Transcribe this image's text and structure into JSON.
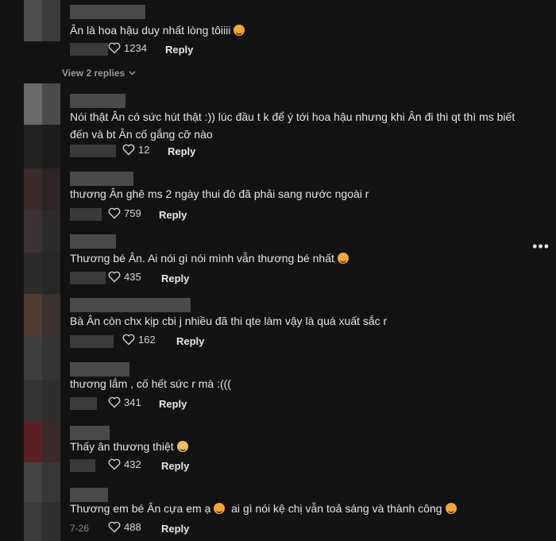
{
  "view_replies": "View 2 replies",
  "more_label": "•••",
  "comments": [
    {
      "text": "Ân là hoa hậu duy nhất lòng tôiiii",
      "likes": "1234",
      "reply": "Reply",
      "date": ""
    },
    {
      "text": "Nói thật Ân có sức hút thật :)) lúc đầu t k để ý tới hoa hậu nhưng khi Ân đi thi qt thì ms biết đến và bt Ân cố gắng cỡ nào",
      "likes": "12",
      "reply": "Reply",
      "date": ""
    },
    {
      "text": "thương Ân ghê ms 2 ngày thui đó đã phải sang nước ngoài r",
      "likes": "759",
      "reply": "Reply",
      "date": ""
    },
    {
      "text": "Thương bé Ân. Ai nói gì nói mình vẫn thương bé nhất",
      "likes": "435",
      "reply": "Reply",
      "date": ""
    },
    {
      "text": "Bà Ân còn chx kịp cbi j nhiều đã thi qte làm vậy là quá xuất sắc r",
      "likes": "162",
      "reply": "Reply",
      "date": ""
    },
    {
      "text": "thương lắm , cố hết sức r mà :(((",
      "likes": "341",
      "reply": "Reply",
      "date": ""
    },
    {
      "text": "Thấy ân thương thiệt",
      "likes": "432",
      "reply": "Reply",
      "date": ""
    },
    {
      "text": "Thương em bé Ân cựa em ạ",
      "text2": "ai gì nói kệ chị vẫn toả sáng và thành công",
      "likes": "488",
      "reply": "Reply",
      "date": "7-26"
    }
  ],
  "colors": {
    "background": "#121212",
    "text": "#e6e6e6",
    "muted": "#9a9a9a"
  }
}
